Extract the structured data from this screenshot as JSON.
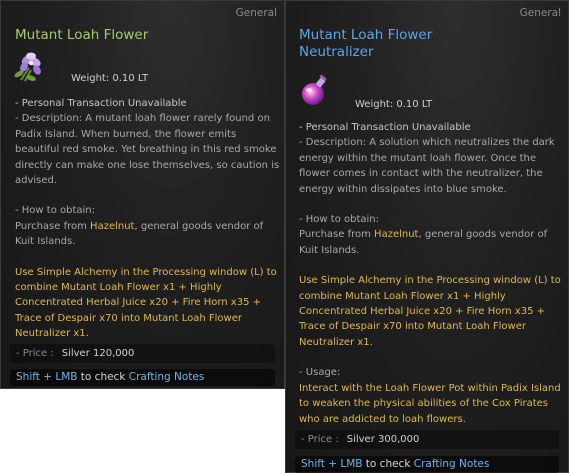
{
  "tooltips": [
    {
      "category": "General",
      "title_lines": [
        "Mutant Loah Flower"
      ],
      "icon": "purple-flower-icon",
      "weight": "Weight:   0.10 LT",
      "trade": "- Personal Transaction Unavailable",
      "description": [
        "- Description: A mutant loah flower rarely found on",
        "Padix Island. When burned, the flower emits",
        "beautiful red smoke. Yet breathing in this red smoke",
        "directly can make one lose themselves, so caution is",
        "advised."
      ],
      "obtain_label": "- How to obtain:",
      "obtain_prefix": "Purchase from ",
      "obtain_npc": "Hazelnut",
      "obtain_suffix": ", general goods vendor of",
      "obtain_line2": "Kuit Islands.",
      "alchemy": [
        "Use Simple Alchemy in the Processing window (L) to",
        "combine Mutant Loah Flower x1 + Highly",
        "Concentrated Herbal Juice x20 + Fire Horn x35 +",
        "Trace of Despair x70 into Mutant Loah Flower",
        "Neutralizer x1."
      ],
      "price_label": "- Price :",
      "price_value": "Silver 120,000",
      "footer_key": "Shift + LMB",
      "footer_mid": " to check ",
      "footer_link": "Crafting Notes"
    },
    {
      "category": "General",
      "title_lines": [
        "Mutant Loah Flower",
        "Neutralizer"
      ],
      "icon": "pink-potion-icon",
      "weight": "Weight:   0.10 LT",
      "trade": "- Personal Transaction Unavailable",
      "description": [
        "- Description: A solution which neutralizes the dark",
        "energy within the mutant loah flower. Once the",
        "flower comes in contact with the neutralizer, the",
        "energy within dissipates into blue smoke."
      ],
      "obtain_label": "- How to obtain:",
      "obtain_prefix": "Purchase from ",
      "obtain_npc": "Hazelnut",
      "obtain_suffix": ", general goods vendor of",
      "obtain_line2": "Kuit Islands.",
      "alchemy": [
        "Use Simple Alchemy in the Processing window (L) to",
        "combine Mutant Loah Flower x1 + Highly",
        "Concentrated Herbal Juice x20 + Fire Horn x35 +",
        "Trace of Despair x70 into Mutant Loah Flower",
        "Neutralizer x1."
      ],
      "usage_label": "- Usage:",
      "usage": [
        "Interact with the Loah Flower Pot within Padix Island",
        "to weaken the physical abilities of the Cox Pirates",
        "who are addicted to loah flowers."
      ],
      "price_label": "- Price :",
      "price_value": "Silver 300,000",
      "footer_key": "Shift + LMB",
      "footer_mid": " to check ",
      "footer_link": "Crafting Notes"
    }
  ]
}
